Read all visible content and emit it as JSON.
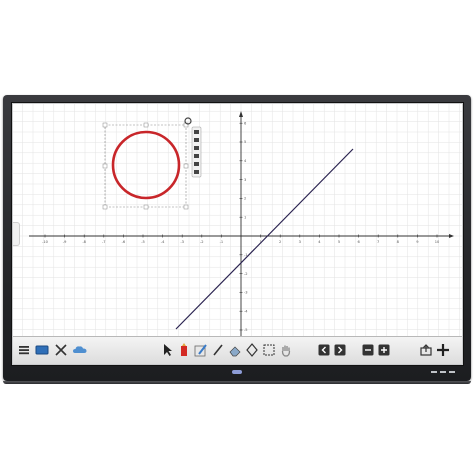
{
  "board": {
    "x_tick_labels": [
      "-10",
      "-9",
      "-8",
      "-7",
      "-6",
      "-5",
      "-4",
      "-3",
      "-2",
      "-1",
      "1",
      "2",
      "3",
      "4",
      "5",
      "6",
      "7",
      "8",
      "9",
      "10"
    ],
    "y_tick_labels": [
      "6",
      "5",
      "4",
      "3",
      "2",
      "1",
      "-1",
      "-2",
      "-3",
      "-4",
      "-5",
      "-6"
    ],
    "line_color": "#2a2350",
    "circle_color": "#c8262a"
  },
  "toolbar": {
    "left_tools": [
      "menu-icon",
      "display-icon",
      "tools-icon",
      "cloud-icon"
    ],
    "center_tools": [
      "pointer-icon",
      "pen-icon",
      "text-icon",
      "line-tool-icon",
      "eraser-icon",
      "shape-icon",
      "screenshot-icon",
      "hand-icon"
    ],
    "right_tools": [
      "prev-page-icon",
      "next-page-icon",
      "zoom-out-icon",
      "zoom-in-icon",
      "export-icon",
      "add-page-icon"
    ]
  },
  "colors": {
    "bezel": "#26272a",
    "grid": "#e3e3e3",
    "axis": "#333333",
    "accent": "#8d9cd6"
  }
}
